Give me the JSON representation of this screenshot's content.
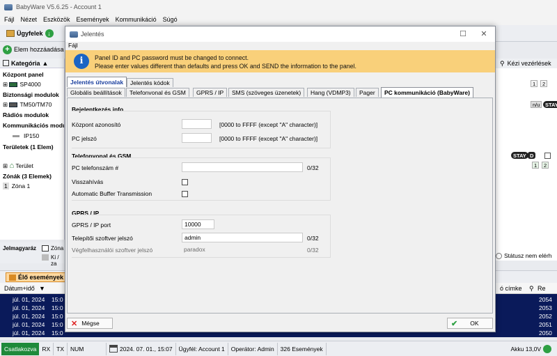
{
  "app": {
    "title": "BabyWare V5.6.25 - Account 1",
    "menu": [
      "Fájl",
      "Nézet",
      "Eszközök",
      "Események",
      "Kommunikáció",
      "Súgó"
    ],
    "toolbar": {
      "customers": "Ügyfelek",
      "add": "Elem hozzáadása"
    }
  },
  "tree": {
    "header": "Kategória",
    "rows": [
      {
        "text": "Központ panel",
        "bold": true
      },
      {
        "text": "SP4000",
        "bold": false
      },
      {
        "text": "Biztonsági modulok",
        "bold": true
      },
      {
        "text": "TM50/TM70",
        "bold": false
      },
      {
        "text": "Rádiós modulok",
        "bold": true
      },
      {
        "text": "Kommunikációs modulok",
        "bold": true
      },
      {
        "text": "IP150",
        "bold": false
      },
      {
        "text": "Területek (1 Elem)",
        "bold": true
      },
      {
        "text": "Terület",
        "bold": false
      },
      {
        "text": "Zónák (3 Elemek)",
        "bold": true
      },
      {
        "text": "Zóna 1",
        "bold": false
      }
    ],
    "zone_index": "1"
  },
  "right_panel": {
    "header": "Kézi vezérlések",
    "chips_row1": [
      "1",
      "2"
    ],
    "chip_nu": "n/u",
    "chip_stay": "STAY",
    "chip_stay_d": "D",
    "chips_row2": [
      "1",
      "2"
    ],
    "status_label": "Státusz nem elérh"
  },
  "legend": {
    "title": "Jelmagyaráz",
    "zone": "Zóna",
    "off": "Ki / za"
  },
  "events": {
    "tab": "Élő események",
    "columns": {
      "datetime": "Dátum+idő",
      "label": "ó címke",
      "ref": "Re"
    },
    "rows": [
      {
        "date": "júl. 01, 2024",
        "time": "15:0",
        "ref": "2054"
      },
      {
        "date": "júl. 01, 2024",
        "time": "15:0",
        "ref": "2053"
      },
      {
        "date": "júl. 01, 2024",
        "time": "15:0",
        "ref": "2052"
      },
      {
        "date": "júl. 01, 2024",
        "time": "15:0",
        "ref": "2051"
      },
      {
        "date": "júl. 01, 2024",
        "time": "15:0",
        "ref": "2050"
      }
    ]
  },
  "status_bar": {
    "connect": "Csatlakozva",
    "rx": "RX",
    "tx": "TX",
    "num": "NUM",
    "datetime": "2024. 07. 01., 15:07",
    "customer": "Ügyfél: Account 1",
    "operator": "Operátor: Admin",
    "events_count": "326 Események",
    "battery": "Akku 13,0V"
  },
  "dialog": {
    "title": "Jelentés",
    "menu": "Fájl",
    "info_line1": "Panel ID and PC password must be changed to connect.",
    "info_line2": "Please enter values different than defaults and press OK and SEND the information to the panel.",
    "top_tabs": [
      "Jelentés útvonalak",
      "Jelentés kódok"
    ],
    "sub_tabs": [
      "Globális beállítások",
      "Telefonvonal és GSM",
      "GPRS / IP",
      "SMS (szöveges üzenetek)",
      "Hang (VDMP3)",
      "Pager",
      "PC kommunikáció (BabyWare)"
    ],
    "login": {
      "title": "Bejelentkezés info",
      "panel_id_label": "Központ azonosító",
      "panel_id_value": "",
      "panel_id_hint": "[0000 to FFFF (except \"A\" character)]",
      "pc_pw_label": "PC jelszó",
      "pc_pw_value": "",
      "pc_pw_hint": "[0000 to FFFF (except \"A\" character)]"
    },
    "phone": {
      "title": "Telefonvonal és GSM",
      "pc_phone_label": "PC telefonszám #",
      "pc_phone_value": "",
      "pc_phone_count": "0/32",
      "callback_label": "Visszahívás",
      "buffer_label": "Automatic Buffer Transmission"
    },
    "gprs": {
      "title": "GPRS / IP",
      "port_label": "GPRS / IP port",
      "port_value": "10000",
      "installer_label": "Telepítői szoftver jelszó",
      "installer_value": "admin",
      "installer_count": "0/32",
      "enduser_label": "Végfelhasználói szoftver jelszó",
      "enduser_value": "paradox",
      "enduser_count": "0/32"
    },
    "cancel": "Mégse",
    "ok": "OK"
  }
}
